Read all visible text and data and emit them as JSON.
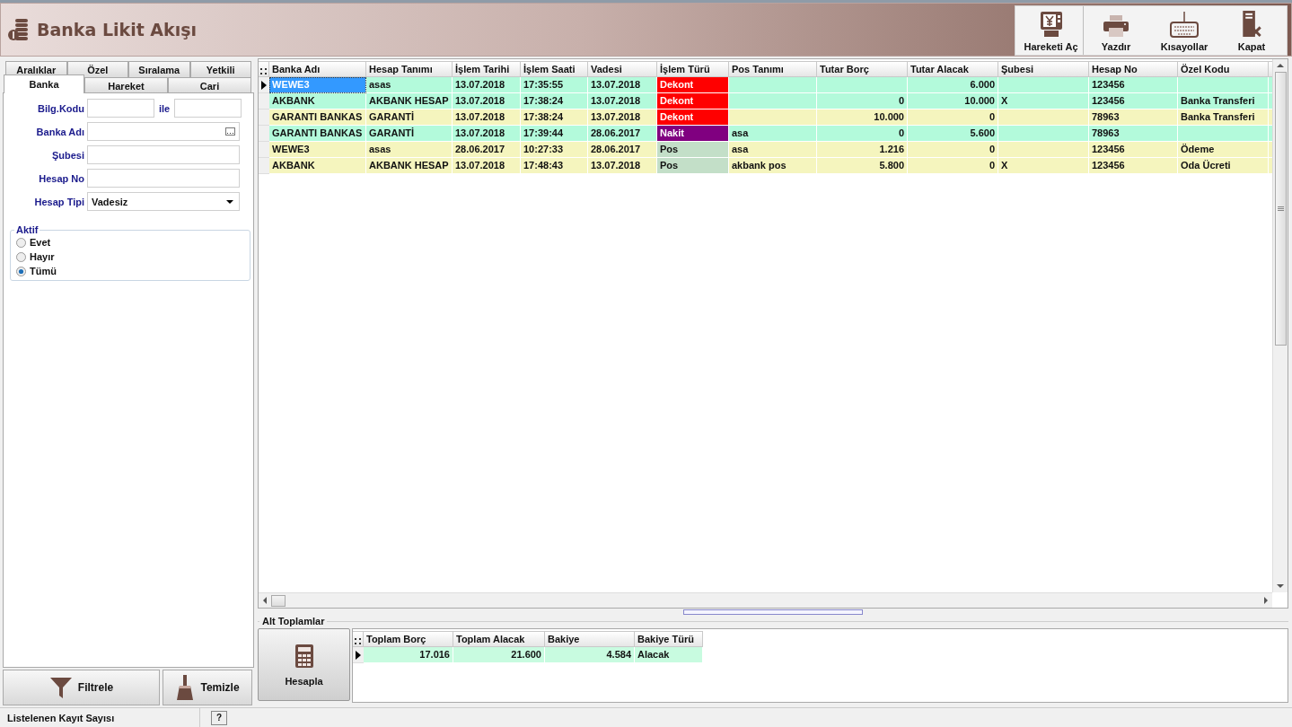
{
  "window": {
    "title": "Banka Likit Akışı"
  },
  "toolbar": [
    {
      "label": "Hareketi Aç",
      "kind": "atm"
    },
    {
      "label": "Yazdır",
      "kind": "printer"
    },
    {
      "label": "Kısayollar",
      "kind": "keyboard"
    },
    {
      "label": "Kapat",
      "kind": "exit"
    }
  ],
  "filter_tabs": {
    "top_row": [
      {
        "label": "Aralıklar",
        "selected": false
      },
      {
        "label": "Özel",
        "selected": false
      },
      {
        "label": "Sıralama",
        "selected": false
      },
      {
        "label": "Yetkili",
        "selected": false
      }
    ],
    "bottom_row": [
      {
        "label": "Banka",
        "selected": true
      },
      {
        "label": "Hareket",
        "selected": false
      },
      {
        "label": "Cari",
        "selected": false
      }
    ]
  },
  "fields": [
    {
      "label": "Bilg.Kodu",
      "kind": "range",
      "connector": "ile"
    },
    {
      "label": "Banka Adı",
      "kind": "lookup"
    },
    {
      "label": "Şubesi",
      "kind": "text"
    },
    {
      "label": "Hesap No",
      "kind": "text"
    },
    {
      "label": "Hesap Tipi",
      "kind": "select",
      "value": "Vadesiz"
    }
  ],
  "aktif": {
    "title": "Aktif",
    "options": [
      {
        "label": "Evet",
        "selected": false
      },
      {
        "label": "Hayır",
        "selected": false
      },
      {
        "label": "Tümü",
        "selected": true
      }
    ]
  },
  "buttons": [
    {
      "label": "Filtrele",
      "kind": "filter"
    },
    {
      "label": "Temizle",
      "kind": "broom"
    }
  ],
  "table": {
    "columns": [
      "Banka Adı",
      "Hesap Tanımı",
      "İşlem Tarihi",
      "İşlem Saati",
      "Vadesi",
      "İşlem Türü",
      "Pos Tanımı",
      "Tutar Borç",
      "Tutar Alacak",
      "Şubesi",
      "Hesap No",
      "Özel Kodu"
    ],
    "rows": [
      {
        "selected": true,
        "color": "#b3fadb",
        "cells": [
          "WEWE3",
          "asas",
          "13.07.2018",
          "17:35:55",
          "13.07.2018",
          {
            "text": "Dekont",
            "color": "#ff0000"
          },
          "",
          "",
          "6.000",
          "",
          "123456",
          ""
        ]
      },
      {
        "selected": false,
        "color": "#b3fadb",
        "cells": [
          "AKBANK",
          "AKBANK HESAP",
          "13.07.2018",
          "17:38:24",
          "13.07.2018",
          {
            "text": "Dekont",
            "color": "#ff0000"
          },
          "",
          "0",
          "10.000",
          "X",
          "123456",
          "Banka Transferi"
        ]
      },
      {
        "selected": false,
        "color": "#f5f5be",
        "cells": [
          "GARANTI BANKAS",
          "GARANTİ",
          "13.07.2018",
          "17:38:24",
          "13.07.2018",
          {
            "text": "Dekont",
            "color": "#ff0000"
          },
          "",
          "10.000",
          "0",
          "",
          "78963",
          "Banka Transferi"
        ]
      },
      {
        "selected": false,
        "color": "#b3fadb",
        "cells": [
          "GARANTI BANKAS",
          "GARANTİ",
          "13.07.2018",
          "17:39:44",
          "28.06.2017",
          {
            "text": "Nakit",
            "color": "#800080"
          },
          "asa",
          "0",
          "5.600",
          "",
          "78963",
          ""
        ]
      },
      {
        "selected": false,
        "color": "#f5f5be",
        "cells": [
          "WEWE3",
          "asas",
          "28.06.2017",
          "10:27:33",
          "28.06.2017",
          {
            "text": "Pos",
            "color": "#c3dfc8"
          },
          "asa",
          "1.216",
          "0",
          "",
          "123456",
          "Ödeme"
        ]
      },
      {
        "selected": false,
        "color": "#f5f5be",
        "cells": [
          "AKBANK",
          "AKBANK HESAP",
          "13.07.2018",
          "17:48:43",
          "13.07.2018",
          {
            "text": "Pos",
            "color": "#c3dfc8"
          },
          "akbank pos",
          "5.800",
          "0",
          "X",
          "123456",
          "Oda Ücreti"
        ]
      }
    ]
  },
  "totals": {
    "title": "Alt Toplamlar",
    "button": "Hesapla",
    "columns": [
      "Toplam Borç",
      "Toplam Alacak",
      "Bakiye",
      "Bakiye Türü"
    ],
    "rows": [
      {
        "selected": true,
        "color": "#c8fbe0",
        "cells": [
          "17.016",
          "21.600",
          "4.584",
          "Alacak"
        ]
      }
    ]
  },
  "status_bar": {
    "label": "Listelenen Kayıt Sayısı",
    "help": "?"
  }
}
